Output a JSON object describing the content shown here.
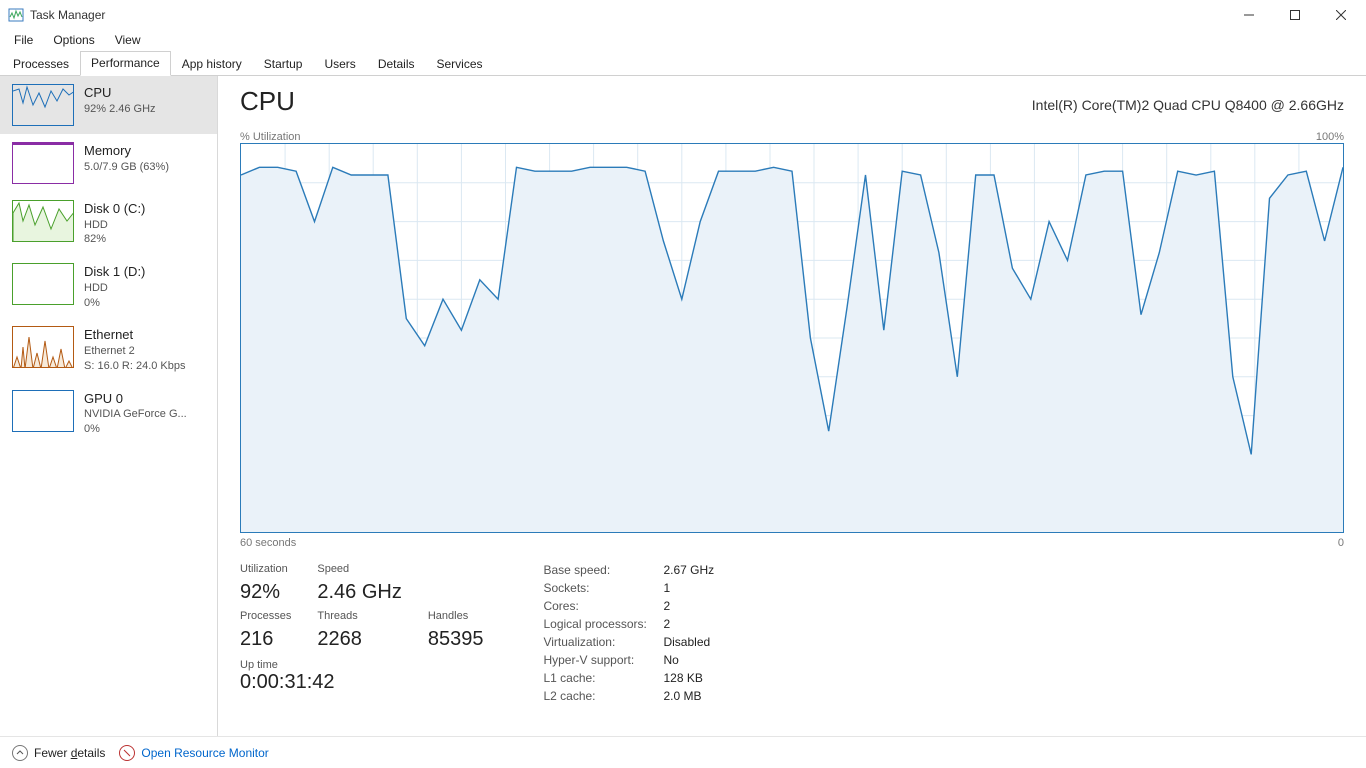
{
  "window": {
    "title": "Task Manager",
    "min_tip": "Minimize",
    "max_tip": "Maximize",
    "close_tip": "Close"
  },
  "menu": {
    "items": [
      "File",
      "Options",
      "View"
    ]
  },
  "tabs": {
    "items": [
      "Processes",
      "Performance",
      "App history",
      "Startup",
      "Users",
      "Details",
      "Services"
    ],
    "active_index": 1
  },
  "sidebar": {
    "items": [
      {
        "title": "CPU",
        "line2": "92%  2.46 GHz",
        "line3": "",
        "color": "#1e6fb8",
        "selected": true,
        "thumb": "cpu"
      },
      {
        "title": "Memory",
        "line2": "5.0/7.9 GB (63%)",
        "line3": "",
        "color": "#8a2da5",
        "selected": false,
        "thumb": "mem"
      },
      {
        "title": "Disk 0 (C:)",
        "line2": "HDD",
        "line3": "82%",
        "color": "#4aa02c",
        "selected": false,
        "thumb": "disk0"
      },
      {
        "title": "Disk 1 (D:)",
        "line2": "HDD",
        "line3": "0%",
        "color": "#4aa02c",
        "selected": false,
        "thumb": "disk1"
      },
      {
        "title": "Ethernet",
        "line2": "Ethernet 2",
        "line3": "S: 16.0  R: 24.0 Kbps",
        "color": "#b35a13",
        "selected": false,
        "thumb": "eth"
      },
      {
        "title": "GPU 0",
        "line2": "NVIDIA GeForce G...",
        "line3": "0%",
        "color": "#1e6fb8",
        "selected": false,
        "thumb": "gpu"
      }
    ]
  },
  "header": {
    "title": "CPU",
    "subtitle": "Intel(R) Core(TM)2 Quad CPU Q8400 @ 2.66GHz",
    "top_left_label": "% Utilization",
    "top_right_label": "100%",
    "bottom_left_label": "60 seconds",
    "bottom_right_label": "0"
  },
  "chart_data": {
    "type": "area",
    "title": "% Utilization",
    "xlabel": "seconds ago",
    "ylabel": "% Utilization",
    "ylim": [
      0,
      100
    ],
    "xlim": [
      60,
      0
    ],
    "x": [
      60,
      59,
      58,
      57,
      56,
      55,
      54,
      53,
      52,
      51,
      50,
      49,
      48,
      47,
      46,
      45,
      44,
      43,
      42,
      41,
      40,
      39,
      38,
      37,
      36,
      35,
      34,
      33,
      32,
      31,
      30,
      29,
      28,
      27,
      26,
      25,
      24,
      23,
      22,
      21,
      20,
      19,
      18,
      17,
      16,
      15,
      14,
      13,
      12,
      11,
      10,
      9,
      8,
      7,
      6,
      5,
      4,
      3,
      2,
      1,
      0
    ],
    "values": [
      92,
      94,
      94,
      93,
      80,
      94,
      92,
      92,
      92,
      55,
      48,
      60,
      52,
      65,
      60,
      94,
      93,
      93,
      93,
      94,
      94,
      94,
      93,
      75,
      60,
      80,
      93,
      93,
      93,
      94,
      93,
      50,
      26,
      58,
      92,
      52,
      93,
      92,
      72,
      40,
      92,
      92,
      68,
      60,
      80,
      70,
      92,
      93,
      93,
      56,
      72,
      93,
      92,
      93,
      40,
      20,
      86,
      92,
      93,
      75,
      94
    ],
    "line_color": "#2b7bb9",
    "fill_color": "#eaf2f9",
    "grid_color": "#dbe8f2"
  },
  "stats": {
    "left": {
      "utilization_label": "Utilization",
      "utilization": "92%",
      "speed_label": "Speed",
      "speed": "2.46 GHz",
      "processes_label": "Processes",
      "processes": "216",
      "threads_label": "Threads",
      "threads": "2268",
      "handles_label": "Handles",
      "handles": "85395",
      "uptime_label": "Up time",
      "uptime": "0:00:31:42"
    },
    "right": [
      {
        "label": "Base speed:",
        "value": "2.67 GHz"
      },
      {
        "label": "Sockets:",
        "value": "1"
      },
      {
        "label": "Cores:",
        "value": "2"
      },
      {
        "label": "Logical processors:",
        "value": "2"
      },
      {
        "label": "Virtualization:",
        "value": "Disabled"
      },
      {
        "label": "Hyper-V support:",
        "value": "No"
      },
      {
        "label": "L1 cache:",
        "value": "128 KB"
      },
      {
        "label": "L2 cache:",
        "value": "2.0 MB"
      }
    ]
  },
  "footer": {
    "fewer_prefix": "Fewer ",
    "fewer_key": "d",
    "fewer_suffix": "etails",
    "resource_monitor": "Open Resource Monitor"
  }
}
